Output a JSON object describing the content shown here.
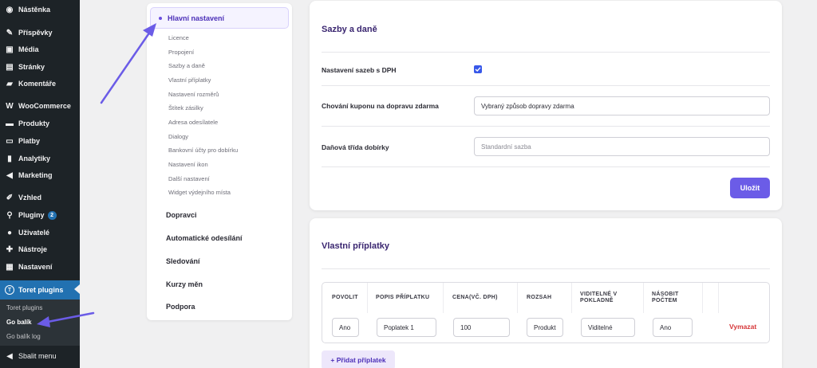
{
  "sidebar": {
    "items": [
      {
        "label": "Nástěnka",
        "icon": "dashboard-icon"
      },
      {
        "label": "Příspěvky",
        "icon": "pin-icon"
      },
      {
        "label": "Média",
        "icon": "media-icon"
      },
      {
        "label": "Stránky",
        "icon": "page-icon"
      },
      {
        "label": "Komentáře",
        "icon": "comment-icon"
      },
      {
        "label": "WooCommerce",
        "icon": "woo-icon"
      },
      {
        "label": "Produkty",
        "icon": "archive-icon"
      },
      {
        "label": "Platby",
        "icon": "payments-icon"
      },
      {
        "label": "Analytiky",
        "icon": "bar-chart-icon"
      },
      {
        "label": "Marketing",
        "icon": "megaphone-icon"
      },
      {
        "label": "Vzhled",
        "icon": "brush-icon"
      },
      {
        "label": "Pluginy",
        "icon": "plugin-icon",
        "badge": "2"
      },
      {
        "label": "Uživatelé",
        "icon": "user-icon"
      },
      {
        "label": "Nástroje",
        "icon": "wrench-icon"
      },
      {
        "label": "Nastavení",
        "icon": "settings-icon"
      },
      {
        "label": "Toret plugins",
        "icon": "toret-icon"
      }
    ],
    "submenu": [
      "Toret plugins",
      "Go balík",
      "Go balík log"
    ],
    "collapse": "Sbalit menu"
  },
  "settings_nav": {
    "active": "Hlavní nastavení",
    "sub": [
      "Licence",
      "Propojení",
      "Sazby a daně",
      "Vlastní příplatky",
      "Nastavení rozměrů",
      "Štítek zásilky",
      "Adresa odesílatele",
      "Dialogy",
      "Bankovní účty pro dobírku",
      "Nastavení ikon",
      "Další nastavení",
      "Widget výdejního místa"
    ],
    "main": [
      "Dopravci",
      "Automatické odesílání",
      "Sledování",
      "Kurzy měn",
      "Podpora"
    ]
  },
  "rates": {
    "title": "Sazby a daně",
    "vat_label": "Nastavení sazeb s DPH",
    "vat_checked": true,
    "coupon_label": "Chování kuponu na dopravu zdarma",
    "coupon_value": "Vybraný způsob dopravy zdarma",
    "tax_label": "Daňová třída dobírky",
    "tax_placeholder": "Standardní sazba",
    "save": "Uložit"
  },
  "surcharges": {
    "title": "Vlastní příplatky",
    "columns": [
      "POVOLIT",
      "POPIS PŘÍPLATKU",
      "CENA(VČ. DPH)",
      "ROZSAH",
      "VIDITELNÉ V POKLADNĚ",
      "NÁSOBIT POČTEM"
    ],
    "row": {
      "enable": "Ano",
      "description": "Poplatek 1",
      "price": "100",
      "scope": "Produkt",
      "visible": "Viditelné",
      "multiply": "Ano"
    },
    "delete": "Vymazat",
    "add": "+ Přidat příplatek"
  },
  "colors": {
    "accent": "#6b5ce7",
    "wp_sidebar": "#1d2327",
    "wp_active": "#2271b1",
    "delete": "#d63638",
    "annotation_arrow": "#6b5ce7"
  }
}
